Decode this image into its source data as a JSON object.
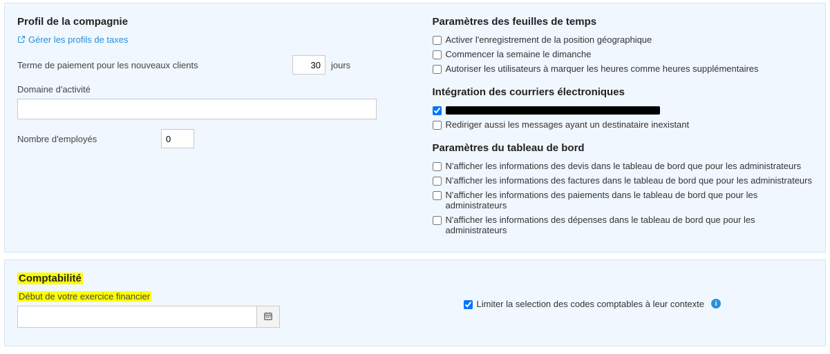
{
  "company_profile": {
    "title": "Profil de la compagnie",
    "tax_link": "Gérer les profils de taxes",
    "payment_term_label": "Terme de paiement pour les nouveaux clients",
    "payment_term_value": "30",
    "payment_term_unit": "jours",
    "activity_label": "Domaine d'activité",
    "activity_value": "",
    "employees_label": "Nombre d'employés",
    "employees_value": "0"
  },
  "timesheet": {
    "title": "Paramètres des feuilles de temps",
    "geo": "Activer l'enregistrement de la position géographique",
    "sunday": "Commencer la semaine le dimanche",
    "overtime": "Autoriser les utilisateurs à marquer les heures comme heures supplémentaires"
  },
  "email": {
    "title": "Intégration des courriers électroniques",
    "redirect": "Rediriger aussi les messages ayant un destinataire inexistant"
  },
  "dashboard": {
    "title": "Paramètres du tableau de bord",
    "quotes": "N'afficher les informations des devis dans le tableau de bord que pour les administrateurs",
    "invoices": "N'afficher les informations des factures dans le tableau de bord que pour les administrateurs",
    "payments": "N'afficher les informations des paiements dans le tableau de bord que pour les administrateurs",
    "expenses": "N'afficher les informations des dépenses dans le tableau de bord que pour les administrateurs"
  },
  "accounting": {
    "title": "Comptabilité",
    "fiscal_start_label": "Début de votre exercice financier",
    "fiscal_start_value": "",
    "limit_codes": "Limiter la selection des codes comptables à leur contexte"
  }
}
